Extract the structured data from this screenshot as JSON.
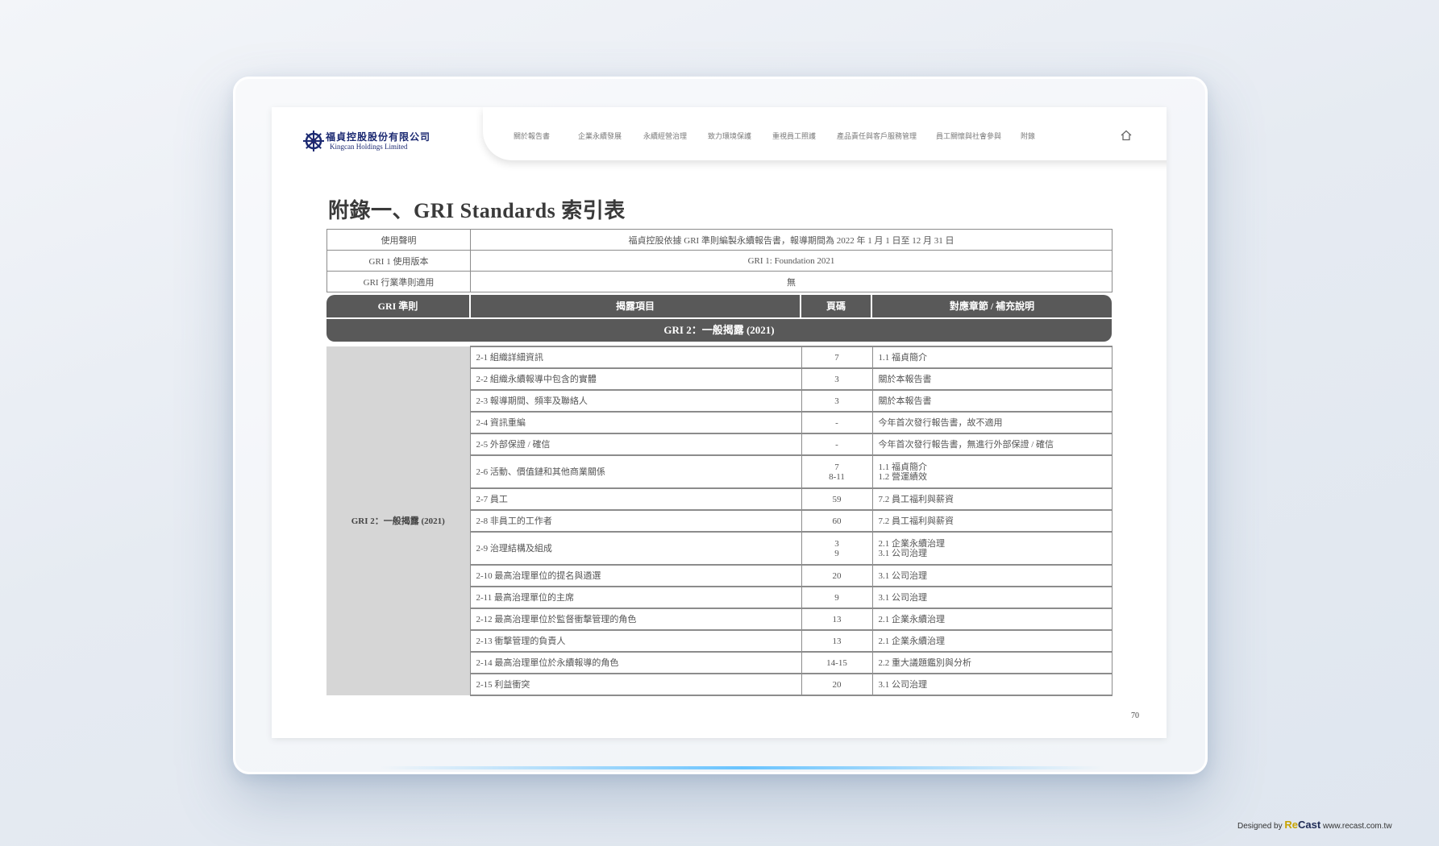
{
  "logo": {
    "company_cn": "福貞控股股份有限公司",
    "company_en": "Kingcan Holdings Limited"
  },
  "nav": {
    "items": [
      "關於報告書",
      "企業永續發展",
      "永續經營治理",
      "致力環境保護",
      "重視員工照護",
      "產品責任與客戶服務管理",
      "員工關懷與社會參與",
      "附錄"
    ],
    "home_icon": "home-icon"
  },
  "title": "附錄一、GRI Standards 索引表",
  "meta": [
    {
      "label": "使用聲明",
      "value": "福貞控股依據 GRI 準則編製永續報告書，報導期間為 2022 年 1 月 1 日至 12 月 31 日"
    },
    {
      "label": "GRI 1 使用版本",
      "value": "GRI 1: Foundation 2021"
    },
    {
      "label": "GRI 行業準則適用",
      "value": "無"
    }
  ],
  "columns": [
    "GRI 準則",
    "揭露項目",
    "頁碼",
    "對應章節 / 補充說明"
  ],
  "section": "GRI 2：一般揭露 (2021)",
  "group_label": "GRI 2：一般揭露 (2021)",
  "rows": [
    {
      "item": "2-1 組織詳細資訊",
      "page": "7",
      "note": "1.1 福貞簡介"
    },
    {
      "item": "2-2 組織永續報導中包含的實體",
      "page": "3",
      "note": "關於本報告書"
    },
    {
      "item": "2-3 報導期間、頻率及聯絡人",
      "page": "3",
      "note": "關於本報告書"
    },
    {
      "item": "2-4 資訊重編",
      "page": "-",
      "note": "今年首次發行報告書，故不適用"
    },
    {
      "item": "2-5 外部保證 / 確信",
      "page": "-",
      "note": "今年首次發行報告書，無進行外部保證 / 確信"
    },
    {
      "item": "2-6 活動、價值鏈和其他商業關係",
      "page": "7\n8-11",
      "note": "1.1 福貞簡介\n1.2 營運績效"
    },
    {
      "item": "2-7 員工",
      "page": "59",
      "note": "7.2 員工福利與薪資"
    },
    {
      "item": "2-8 非員工的工作者",
      "page": "60",
      "note": "7.2 員工福利與薪資"
    },
    {
      "item": "2-9 治理結構及組成",
      "page": "3\n9",
      "note": "2.1 企業永續治理\n3.1 公司治理"
    },
    {
      "item": "2-10 最高治理單位的提名與遴選",
      "page": "20",
      "note": "3.1 公司治理"
    },
    {
      "item": "2-11 最高治理單位的主席",
      "page": "9",
      "note": "3.1 公司治理"
    },
    {
      "item": "2-12 最高治理單位於監督衝擊管理的角色",
      "page": "13",
      "note": "2.1 企業永續治理"
    },
    {
      "item": "2-13 衝擊管理的負責人",
      "page": "13",
      "note": "2.1 企業永續治理"
    },
    {
      "item": "2-14 最高治理單位於永續報導的角色",
      "page": "14-15",
      "note": "2.2 重大議題鑑別與分析"
    },
    {
      "item": "2-15 利益衝突",
      "page": "20",
      "note": "3.1 公司治理"
    }
  ],
  "page_number": "70",
  "credit": {
    "prefix": "Designed by",
    "brand_a": "Re",
    "brand_b": "Cast",
    "url": "www.recast.com.tw"
  }
}
